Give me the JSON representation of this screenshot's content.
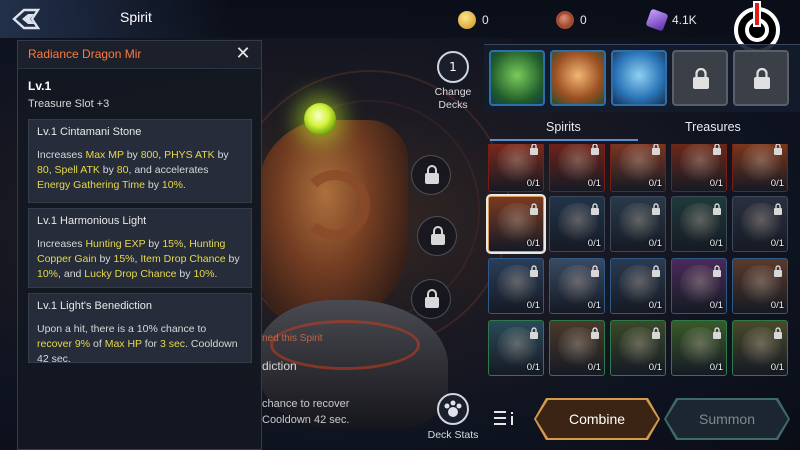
{
  "header": {
    "title": "Spirit",
    "currencies": [
      {
        "icon": "gold-coins-icon",
        "value": "0"
      },
      {
        "icon": "copper-coin-icon",
        "value": "0"
      },
      {
        "icon": "purple-crystal-icon",
        "value": "4.1K"
      }
    ]
  },
  "info_panel": {
    "title": "Radiance Dragon Mir",
    "level": "Lv.1",
    "slot": "Treasure Slot +3",
    "effects": [
      {
        "title": "Lv.1 Cintamani Stone",
        "parts": [
          {
            "t": "Increases ",
            "h": false
          },
          {
            "t": "Max MP",
            "h": true
          },
          {
            "t": " by ",
            "h": false
          },
          {
            "t": "800",
            "h": true
          },
          {
            "t": ", ",
            "h": false
          },
          {
            "t": "PHYS ATK",
            "h": true
          },
          {
            "t": " by ",
            "h": false
          },
          {
            "t": "80",
            "h": true
          },
          {
            "t": ", ",
            "h": false
          },
          {
            "t": "Spell ATK",
            "h": true
          },
          {
            "t": " by ",
            "h": false
          },
          {
            "t": "80",
            "h": true
          },
          {
            "t": ", and accelerates ",
            "h": false
          },
          {
            "t": "Energy Gathering Time",
            "h": true
          },
          {
            "t": " by ",
            "h": false
          },
          {
            "t": "10%",
            "h": true
          },
          {
            "t": ".",
            "h": false
          }
        ]
      },
      {
        "title": "Lv.1 Harmonious Light",
        "parts": [
          {
            "t": "Increases ",
            "h": false
          },
          {
            "t": "Hunting EXP",
            "h": true
          },
          {
            "t": " by ",
            "h": false
          },
          {
            "t": "15%",
            "h": true
          },
          {
            "t": ", ",
            "h": false
          },
          {
            "t": "Hunting Copper Gain",
            "h": true
          },
          {
            "t": " by ",
            "h": false
          },
          {
            "t": "15%",
            "h": true
          },
          {
            "t": ", ",
            "h": false
          },
          {
            "t": "Item Drop Chance",
            "h": true
          },
          {
            "t": " by ",
            "h": false
          },
          {
            "t": "10%",
            "h": true
          },
          {
            "t": ", and ",
            "h": false
          },
          {
            "t": "Lucky Drop Chance",
            "h": true
          },
          {
            "t": " by ",
            "h": false
          },
          {
            "t": "10%",
            "h": true
          },
          {
            "t": ".",
            "h": false
          }
        ]
      },
      {
        "title": "Lv.1 Light's Benediction",
        "parts": [
          {
            "t": "Upon a hit, there is a 10% chance to ",
            "h": false
          },
          {
            "t": "recover 9%",
            "h": true
          },
          {
            "t": " of ",
            "h": false
          },
          {
            "t": "Max HP",
            "h": true
          },
          {
            "t": " for ",
            "h": false
          },
          {
            "t": "3 sec",
            "h": true
          },
          {
            "t": ". Cooldown 42 sec.",
            "h": false
          }
        ]
      }
    ]
  },
  "background_text": {
    "owned": "ned this Spirit",
    "diction": "diction",
    "chance": "chance to recover",
    "cooldown": "Cooldown 42 sec."
  },
  "middle": {
    "change_decks_count": "1",
    "change_decks_label": "Change Decks",
    "deck_stats_label": "Deck Stats"
  },
  "tabs": [
    "Spirits",
    "Treasures"
  ],
  "grid": {
    "count_label": "0/1"
  },
  "actions": {
    "combine": "Combine",
    "summon": "Summon"
  },
  "colors": {
    "accent_orange": "#ff7a3c",
    "highlight_yellow": "#e6d94a",
    "selected_tab": "#5a8fd0"
  }
}
